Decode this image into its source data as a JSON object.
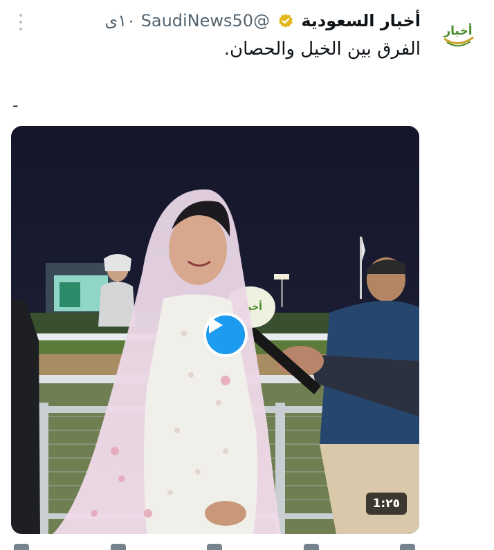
{
  "tweet": {
    "author_name": "أخبار السعودية",
    "handle": "@SaudiNews50",
    "time": "١٠ى",
    "text": "الفرق بين الخيل والحصان.",
    "extra_line": "-"
  },
  "avatar": {
    "logo_text": "أخبار"
  },
  "video": {
    "duration": "1:٢٥",
    "mic_logo": "أخبار"
  },
  "colors": {
    "accent": "#1d9bf0",
    "verified": "#e2b719",
    "secondary_text": "#536471",
    "logo_green": "#4a8a2a"
  }
}
